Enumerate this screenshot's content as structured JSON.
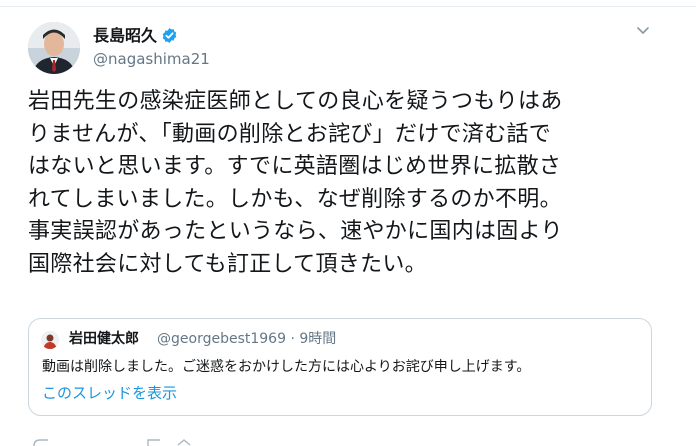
{
  "tweet": {
    "author": {
      "name": "長島昭久",
      "handle": "@nagashima21",
      "avatar_icon": "profile-photo",
      "verified_icon": "verified-badge-icon"
    },
    "menu_icon": "chevron-down-icon",
    "text_lines": [
      "岩田先生の感染症医師としての良心を疑うつもりはあ",
      "りませんが、「動画の削除とお詫び」だけで済む話で",
      "はないと思います。すでに英語圏はじめ世界に拡散さ",
      "れてしまいました。しかも、なぜ削除するのか不明。",
      "事実誤認があったというなら、速やかに国内は固より",
      "国際社会に対しても訂正して頂きたい。"
    ],
    "quoted": {
      "name": "岩田健太郎",
      "meta": "@georgebest1969 · 9時間",
      "text": "動画は削除しました。ご迷惑をおかけした方には心よりお詫び申し上げます。",
      "thread_link": "このスレッドを表示"
    }
  },
  "colors": {
    "primary_text": "#14171a",
    "secondary_text": "#657786",
    "link": "#1b95e0",
    "verified": "#1da1f2",
    "border": "#ccd6dd"
  }
}
